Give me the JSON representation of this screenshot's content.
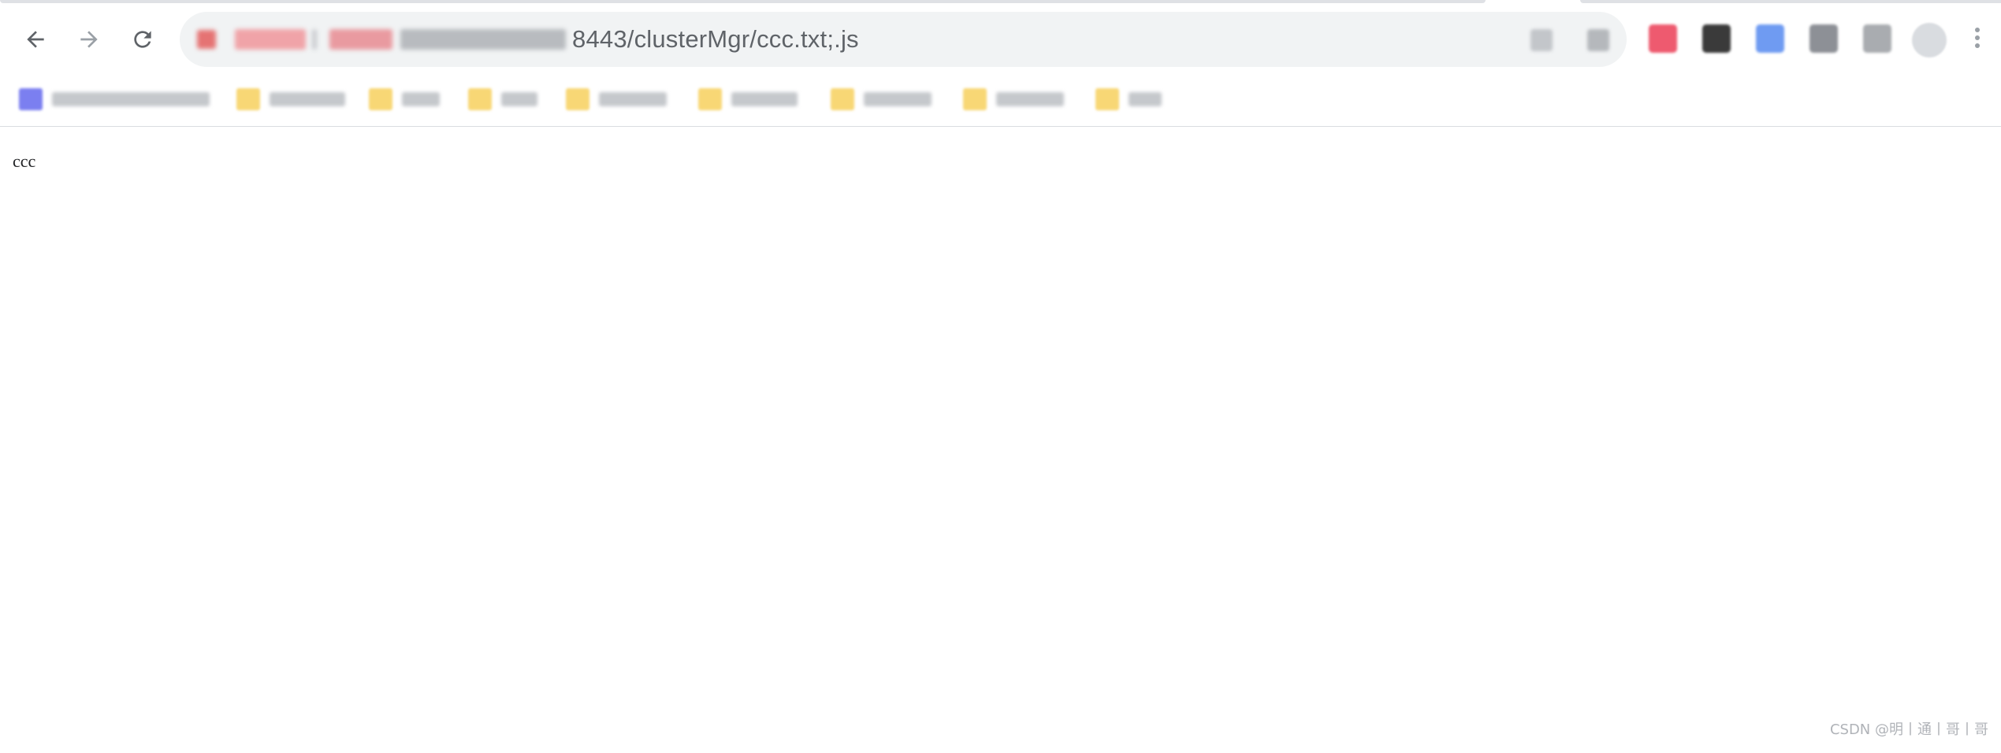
{
  "browser": {
    "address_bar": {
      "url_visible": "8443/clusterMgr/ccc.txt;.js"
    },
    "nav": {
      "back_icon": "arrow-left-icon",
      "forward_icon": "arrow-right-icon",
      "reload_icon": "reload-icon"
    },
    "bookmarks_bar": {
      "items": [
        {
          "icon": "app-icon",
          "color": "#7b7ff0"
        },
        {
          "icon": "folder-icon",
          "color": "#f8d775"
        },
        {
          "icon": "folder-icon",
          "color": "#f8d775"
        },
        {
          "icon": "folder-icon",
          "color": "#f8d775"
        },
        {
          "icon": "folder-icon",
          "color": "#f8d775"
        },
        {
          "icon": "folder-icon",
          "color": "#f8d775"
        },
        {
          "icon": "folder-icon",
          "color": "#f8d775"
        },
        {
          "icon": "folder-icon",
          "color": "#f8d775"
        },
        {
          "icon": "folder-icon",
          "color": "#f8d775"
        }
      ]
    }
  },
  "page": {
    "body_text": "ccc"
  },
  "watermark": {
    "text": "CSDN @明丨通丨哥丨哥"
  }
}
